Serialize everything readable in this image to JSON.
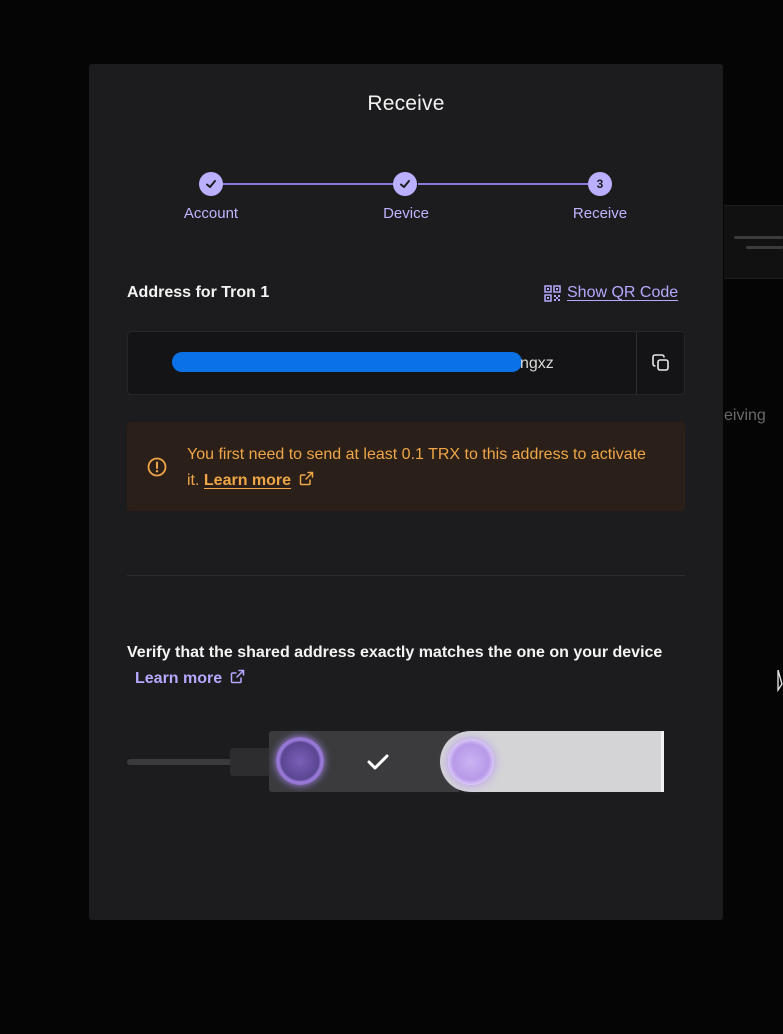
{
  "background": {
    "partial_text": "eiving"
  },
  "modal": {
    "title": "Receive",
    "stepper": {
      "steps": [
        {
          "label": "Account",
          "state": "done"
        },
        {
          "label": "Device",
          "state": "done"
        },
        {
          "label": "Receive",
          "state": "active",
          "number": "3"
        }
      ]
    },
    "address_section": {
      "label": "Address for Tron 1",
      "qr_link": "Show QR Code",
      "address_tail": "ngxz",
      "copy_icon": "copy-icon"
    },
    "warning": {
      "text": "You first need to send at least 0.1 TRX to this address to activate it.",
      "link": "Learn more",
      "icon": "warning-icon"
    },
    "verify": {
      "text": "Verify that the shared address exactly matches the one on your device",
      "link": "Learn more"
    }
  },
  "colors": {
    "accent": "#bbb0ff",
    "warning": "#f0a546",
    "modal_bg": "#1c1c1e",
    "redaction": "#0a72e6"
  }
}
